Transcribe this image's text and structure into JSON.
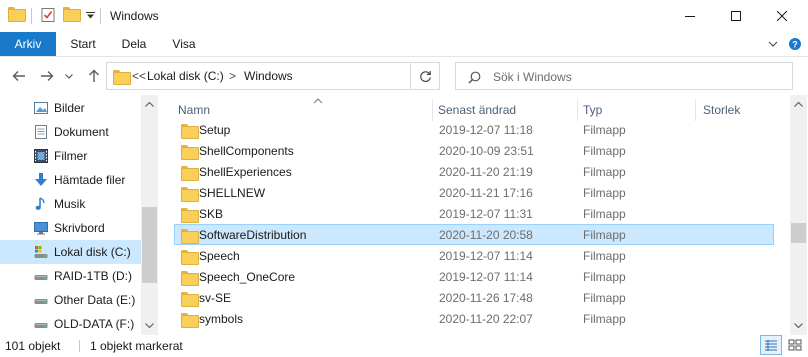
{
  "window": {
    "title": "Windows"
  },
  "ribbon": {
    "tabs": [
      {
        "label": "Arkiv"
      },
      {
        "label": "Start"
      },
      {
        "label": "Dela"
      },
      {
        "label": "Visa"
      }
    ]
  },
  "address": {
    "overflow": "<<",
    "path": [
      "Lokal disk (C:)",
      "Windows"
    ],
    "separator": ">"
  },
  "search": {
    "placeholder": "Sök i Windows"
  },
  "nav_pane": {
    "items": [
      {
        "label": "Bilder",
        "icon": "pictures-icon",
        "selected": false
      },
      {
        "label": "Dokument",
        "icon": "documents-icon",
        "selected": false
      },
      {
        "label": "Filmer",
        "icon": "videos-icon",
        "selected": false
      },
      {
        "label": "Hämtade filer",
        "icon": "downloads-icon",
        "selected": false
      },
      {
        "label": "Musik",
        "icon": "music-icon",
        "selected": false
      },
      {
        "label": "Skrivbord",
        "icon": "desktop-icon",
        "selected": false
      },
      {
        "label": "Lokal disk (C:)",
        "icon": "system-drive-icon",
        "selected": true
      },
      {
        "label": "RAID-1TB (D:)",
        "icon": "drive-icon",
        "selected": false
      },
      {
        "label": "Other Data (E:)",
        "icon": "drive-icon",
        "selected": false
      },
      {
        "label": "OLD-DATA (F:)",
        "icon": "drive-icon",
        "selected": false
      }
    ]
  },
  "columns": {
    "name": "Namn",
    "date": "Senast ändrad",
    "type": "Typ",
    "size": "Storlek"
  },
  "files": [
    {
      "name": "Setup",
      "date": "2019-12-07 11:18",
      "type": "Filmapp",
      "selected": false
    },
    {
      "name": "ShellComponents",
      "date": "2020-10-09 23:51",
      "type": "Filmapp",
      "selected": false
    },
    {
      "name": "ShellExperiences",
      "date": "2020-11-20 21:19",
      "type": "Filmapp",
      "selected": false
    },
    {
      "name": "SHELLNEW",
      "date": "2020-11-21 17:16",
      "type": "Filmapp",
      "selected": false
    },
    {
      "name": "SKB",
      "date": "2019-12-07 11:31",
      "type": "Filmapp",
      "selected": false
    },
    {
      "name": "SoftwareDistribution",
      "date": "2020-11-20 20:58",
      "type": "Filmapp",
      "selected": true
    },
    {
      "name": "Speech",
      "date": "2019-12-07 11:14",
      "type": "Filmapp",
      "selected": false
    },
    {
      "name": "Speech_OneCore",
      "date": "2019-12-07 11:14",
      "type": "Filmapp",
      "selected": false
    },
    {
      "name": "sv-SE",
      "date": "2020-11-26 17:48",
      "type": "Filmapp",
      "selected": false
    },
    {
      "name": "symbols",
      "date": "2020-11-20 22:07",
      "type": "Filmapp",
      "selected": false
    }
  ],
  "status": {
    "count": "101 objekt",
    "selection": "1 objekt markerat"
  },
  "colors": {
    "accent": "#1979ca",
    "selection_bg": "#cce8ff",
    "selection_border": "#99d1ff",
    "folder": "#f9cf5a"
  }
}
